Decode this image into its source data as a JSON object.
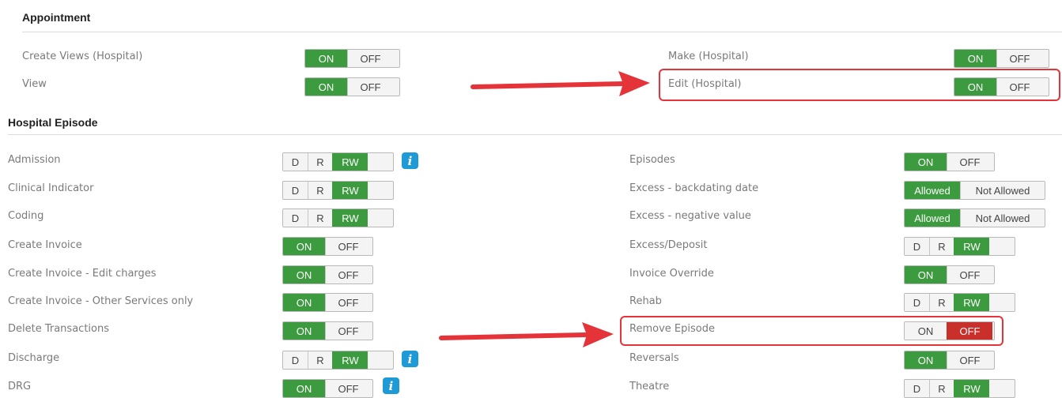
{
  "appointment": {
    "title": "Appointment",
    "left": [
      {
        "label": "Create Views (Hospital)",
        "on": "ON",
        "off": "OFF"
      },
      {
        "label": "View",
        "on": "ON",
        "off": "OFF"
      }
    ],
    "right": [
      {
        "label": "Make (Hospital)",
        "on": "ON",
        "off": "OFF"
      },
      {
        "label": "Edit (Hospital)",
        "on": "ON",
        "off": "OFF"
      }
    ]
  },
  "hospital_episode": {
    "title": "Hospital Episode",
    "left": [
      {
        "label": "Admission",
        "d": "D",
        "r": "R",
        "rw": "RW"
      },
      {
        "label": "Clinical Indicator",
        "d": "D",
        "r": "R",
        "rw": "RW"
      },
      {
        "label": "Coding",
        "d": "D",
        "r": "R",
        "rw": "RW"
      },
      {
        "label": "Create Invoice",
        "on": "ON",
        "off": "OFF"
      },
      {
        "label": "Create Invoice - Edit charges",
        "on": "ON",
        "off": "OFF"
      },
      {
        "label": "Create Invoice - Other Services only",
        "on": "ON",
        "off": "OFF"
      },
      {
        "label": "Delete Transactions",
        "on": "ON",
        "off": "OFF"
      },
      {
        "label": "Discharge",
        "d": "D",
        "r": "R",
        "rw": "RW"
      },
      {
        "label": "DRG",
        "on": "ON",
        "off": "OFF"
      }
    ],
    "right": [
      {
        "label": "Episodes",
        "on": "ON",
        "off": "OFF"
      },
      {
        "label": "Excess - backdating date",
        "allowed": "Allowed",
        "not_allowed": "Not Allowed"
      },
      {
        "label": "Excess - negative value",
        "allowed": "Allowed",
        "not_allowed": "Not Allowed"
      },
      {
        "label": "Excess/Deposit",
        "d": "D",
        "r": "R",
        "rw": "RW"
      },
      {
        "label": "Invoice Override",
        "on": "ON",
        "off": "OFF"
      },
      {
        "label": "Rehab",
        "d": "D",
        "r": "R",
        "rw": "RW"
      },
      {
        "label": "Remove Episode",
        "on": "ON",
        "off": "OFF"
      },
      {
        "label": "Reversals",
        "on": "ON",
        "off": "OFF"
      },
      {
        "label": "Theatre",
        "d": "D",
        "r": "R",
        "rw": "RW"
      }
    ]
  },
  "info_icon_glyph": "i",
  "colors": {
    "active_green": "#3c9a3f",
    "active_red": "#c9302c",
    "info_blue": "#1e9ad6",
    "highlight_red": "#e5333a"
  }
}
